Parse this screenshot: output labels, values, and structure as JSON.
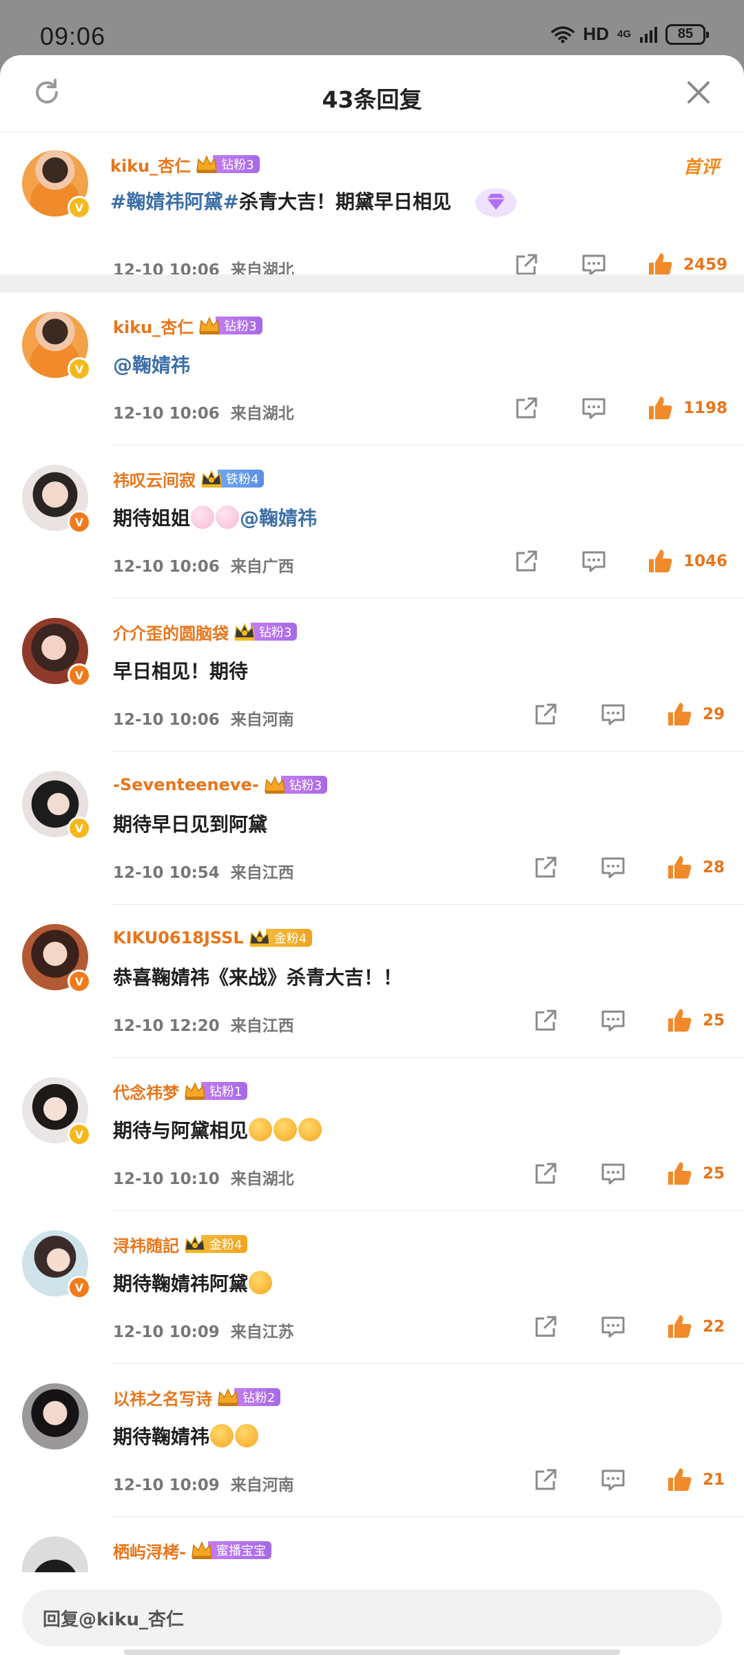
{
  "status_bar": {
    "time": "09:06",
    "network": "HD",
    "signal_gen": "4G",
    "battery": "85"
  },
  "header": {
    "title": "43条回复"
  },
  "comments": [
    {
      "username": "kiku_杏仁",
      "fan_level": "钻粉3",
      "crown_num": "6",
      "text_pre": "",
      "tag": "#鞠婧祎阿黛#",
      "text": "杀青大吉！期黛早日相见",
      "date": "12-10  10:06",
      "location": "来自湖北",
      "likes": "2459",
      "rank": "首评"
    },
    {
      "username": "kiku_杏仁",
      "fan_level": "钻粉3",
      "crown_num": "6",
      "mention": "@鞠婧祎",
      "date": "12-10  10:06",
      "location": "来自湖北",
      "likes": "1198"
    },
    {
      "username": "祎叹云间寂",
      "fan_level": "铁粉4",
      "crown_num": "",
      "text": "期待姐姐",
      "mention": "@鞠婧祎",
      "date": "12-10  10:06",
      "location": "来自广西",
      "likes": "1046"
    },
    {
      "username": "介介歪的圆脑袋",
      "fan_level": "钻粉3",
      "crown_num": "",
      "text": "早日相见！期待",
      "date": "12-10  10:06",
      "location": "来自河南",
      "likes": "29"
    },
    {
      "username": "-Seventeeneve-",
      "fan_level": "钻粉3",
      "crown_num": "5",
      "text": "期待早日见到阿黛",
      "date": "12-10  10:54",
      "location": "来自江西",
      "likes": "28"
    },
    {
      "username": "KIKU0618JSSL",
      "fan_level": "金粉4",
      "crown_num": "",
      "text": "恭喜鞠婧祎《来战》杀青大吉！！",
      "date": "12-10  12:20",
      "location": "来自江西",
      "likes": "25"
    },
    {
      "username": "代念祎梦",
      "fan_level": "钻粉1",
      "crown_num": "5",
      "text": "期待与阿黛相见",
      "date": "12-10  10:10",
      "location": "来自湖北",
      "likes": "25"
    },
    {
      "username": "浔祎随記",
      "fan_level": "金粉4",
      "crown_num": "",
      "text": "期待鞠婧祎阿黛",
      "date": "12-10  10:09",
      "location": "来自江苏",
      "likes": "22"
    },
    {
      "username": "以祎之名写诗",
      "fan_level": "钻粉2",
      "crown_num": "5",
      "text": "期待鞠婧祎",
      "date": "12-10  10:09",
      "location": "来自河南",
      "likes": "21"
    },
    {
      "username": "栖屿浔栲-",
      "fan_level": "蜜播宝宝"
    }
  ],
  "reply_bar": {
    "placeholder": "回复@kiku_杏仁"
  },
  "colors": {
    "accent": "#e8751a",
    "link": "#3c6fa7",
    "diamond": "#a66ae6",
    "iron": "#5b8fe6",
    "gold_fan": "#f0a520"
  },
  "icons": [
    "refresh-icon",
    "close-icon",
    "share-icon",
    "comment-icon",
    "like-icon",
    "crown-icon",
    "verified-icon",
    "diamond-gift-icon"
  ]
}
